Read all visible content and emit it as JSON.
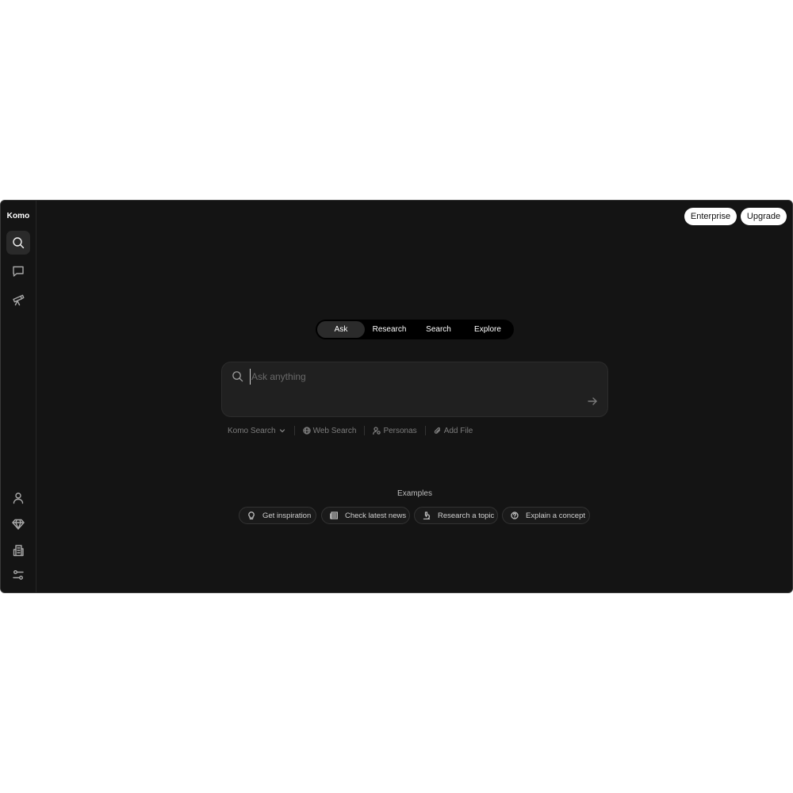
{
  "brand": "Komo",
  "header": {
    "enterprise_label": "Enterprise",
    "upgrade_label": "Upgrade"
  },
  "sidebar": {
    "top_icons": [
      "search-icon",
      "chat-icon",
      "telescope-icon"
    ],
    "bottom_icons": [
      "user-icon",
      "diamond-icon",
      "building-icon",
      "sliders-icon"
    ]
  },
  "mode_tabs": [
    {
      "label": "Ask",
      "active": true
    },
    {
      "label": "Research",
      "active": false
    },
    {
      "label": "Search",
      "active": false
    },
    {
      "label": "Explore",
      "active": false
    }
  ],
  "search": {
    "placeholder": "Ask anything",
    "value": ""
  },
  "tools": {
    "engine": "Komo Search",
    "web_search": "Web Search",
    "personas": "Personas",
    "add_file": "Add File"
  },
  "examples": {
    "title": "Examples",
    "items": [
      "Get inspiration",
      "Check latest news",
      "Research a topic",
      "Explain a concept"
    ]
  }
}
